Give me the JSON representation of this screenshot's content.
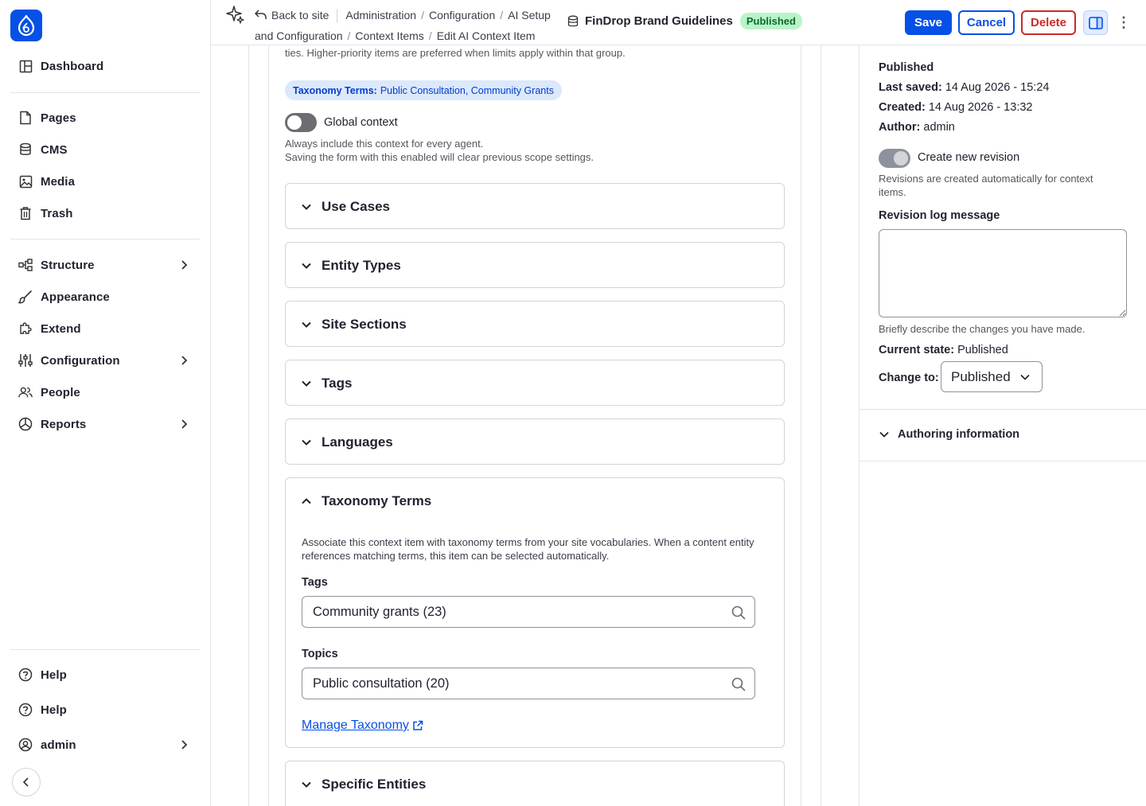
{
  "sidebar": {
    "items": [
      {
        "label": "Dashboard"
      },
      {
        "label": "Pages"
      },
      {
        "label": "CMS"
      },
      {
        "label": "Media"
      },
      {
        "label": "Trash"
      },
      {
        "label": "Structure"
      },
      {
        "label": "Appearance"
      },
      {
        "label": "Extend"
      },
      {
        "label": "Configuration"
      },
      {
        "label": "People"
      },
      {
        "label": "Reports"
      }
    ],
    "footer": [
      {
        "label": "Help"
      },
      {
        "label": "Help"
      },
      {
        "label": "admin"
      }
    ]
  },
  "topbar": {
    "back_label": "Back to site",
    "breadcrumb": [
      "Administration",
      "Configuration",
      "AI Setup and Configuration",
      "Context Items",
      "Edit AI Context Item"
    ],
    "bc_ai_setup_1": "AI Setup",
    "bc_ai_setup_2": "and Configuration",
    "doc_title": "FinDrop Brand Guidelines",
    "status_badge": "Published",
    "save_label": "Save",
    "cancel_label": "Cancel",
    "delete_label": "Delete",
    "more_label": "⋮"
  },
  "main": {
    "cut_text": "ties. Higher-priority items are preferred when limits apply within that group.",
    "chip_label": "Taxonomy Terms:",
    "chip_value": "Public Consultation, Community Grants",
    "global_context": {
      "label": "Global context",
      "enabled": false,
      "desc_1": "Always include this context for every agent.",
      "desc_2": "Saving the form with this enabled will clear previous scope settings."
    },
    "accordions": [
      {
        "label": "Use Cases",
        "expanded": false
      },
      {
        "label": "Entity Types",
        "expanded": false
      },
      {
        "label": "Site Sections",
        "expanded": false
      },
      {
        "label": "Tags",
        "expanded": false
      },
      {
        "label": "Languages",
        "expanded": false
      },
      {
        "label": "Taxonomy Terms",
        "expanded": true
      },
      {
        "label": "Specific Entities",
        "expanded": false
      }
    ],
    "taxonomy": {
      "desc": "Associate this context item with taxonomy terms from your site vocabularies. When a content en­tity references matching terms, this item can be selected automatically.",
      "tags_label": "Tags",
      "tags_value": "Community grants (23)",
      "topics_label": "Topics",
      "topics_value": "Public consultation (20)",
      "manage_link": "Manage Taxonomy"
    }
  },
  "right_panel": {
    "status": "Published",
    "last_saved_label": "Last saved:",
    "last_saved_value": "14 Aug 2026 - 15:24",
    "created_label": "Created:",
    "created_value": "14 Aug 2026 - 13:32",
    "author_label": "Author:",
    "author_value": "admin",
    "new_revision_label": "Create new revision",
    "new_revision_enabled": true,
    "revision_desc": "Revisions are created automatically for context items.",
    "revision_log_label": "Revision log message",
    "revision_log_value": "",
    "revision_help": "Briefly describe the changes you have made.",
    "current_state_label": "Current state:",
    "current_state_value": "Published",
    "change_to_label": "Change to:",
    "change_to_value": "Published",
    "authoring_info": "Authoring information"
  },
  "colors": {
    "accent": "#0550e6",
    "danger": "#c92a2a",
    "published_bg": "#b9f4c9"
  }
}
